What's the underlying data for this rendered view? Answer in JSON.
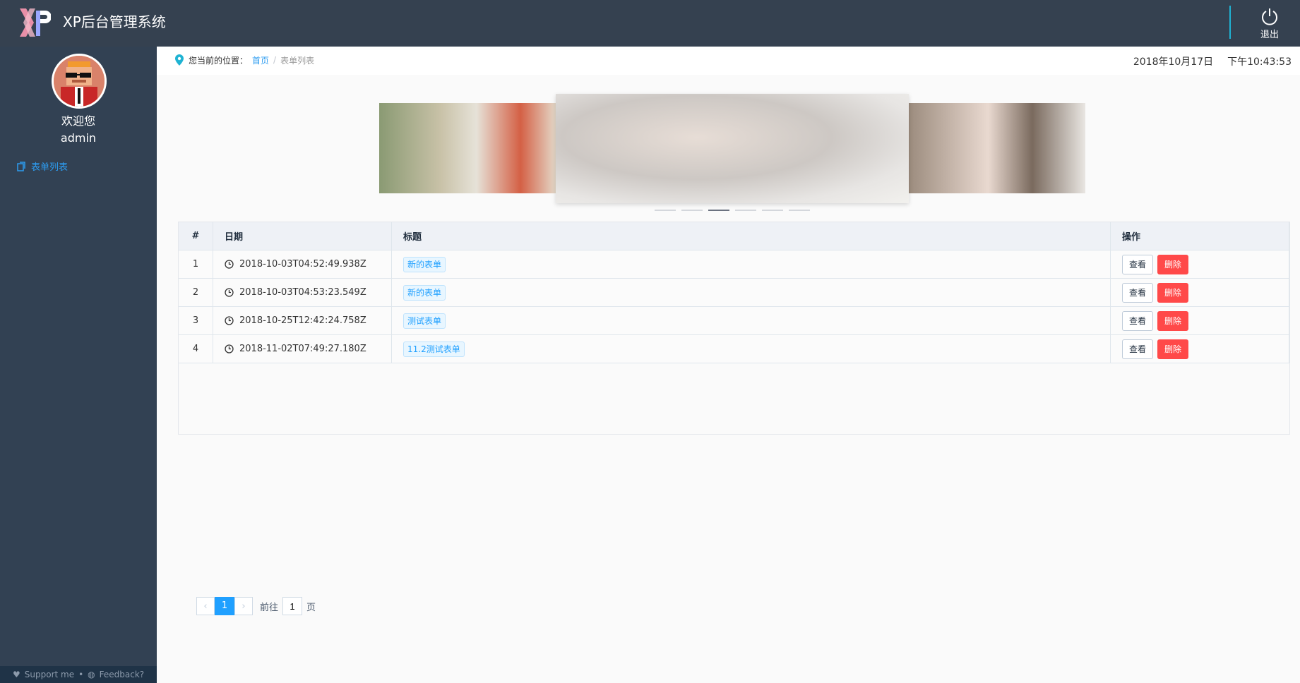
{
  "header": {
    "title": "XP后台管理系统",
    "logout_label": "退出",
    "accent_color": "#1fb3d3",
    "background": "#354150"
  },
  "sidebar": {
    "welcome": "欢迎您",
    "username": "admin",
    "menu": [
      {
        "label": "表单列表",
        "icon": "document-icon",
        "active": true
      }
    ],
    "footer": {
      "support": "Support me",
      "separator": "•",
      "feedback": "Feedback?"
    }
  },
  "breadcrumb": {
    "prefix": "您当前的位置：",
    "home": "首页",
    "separator": "/",
    "current": "表单列表"
  },
  "datetime": {
    "date": "2018年10月17日",
    "time": "下午10:43:53"
  },
  "carousel": {
    "slides": 6,
    "active_index": 2
  },
  "table": {
    "headers": [
      "#",
      "日期",
      "标题",
      "操作"
    ],
    "view_label": "查看",
    "delete_label": "删除",
    "rows": [
      {
        "num": "1",
        "date": "2018-10-03T04:52:49.938Z",
        "title": "新的表单"
      },
      {
        "num": "2",
        "date": "2018-10-03T04:53:23.549Z",
        "title": "新的表单"
      },
      {
        "num": "3",
        "date": "2018-10-25T12:42:24.758Z",
        "title": "测试表单"
      },
      {
        "num": "4",
        "date": "2018-11-02T07:49:27.180Z",
        "title": "11.2测试表单"
      }
    ]
  },
  "pagination": {
    "current_page": "1",
    "goto_label": "前往",
    "goto_value": "1",
    "page_suffix": "页",
    "prev_icon": "chevron-left-icon",
    "next_icon": "chevron-right-icon"
  },
  "colors": {
    "primary": "#20a0ff",
    "danger": "#ff4949",
    "sidebar": "#324153"
  }
}
